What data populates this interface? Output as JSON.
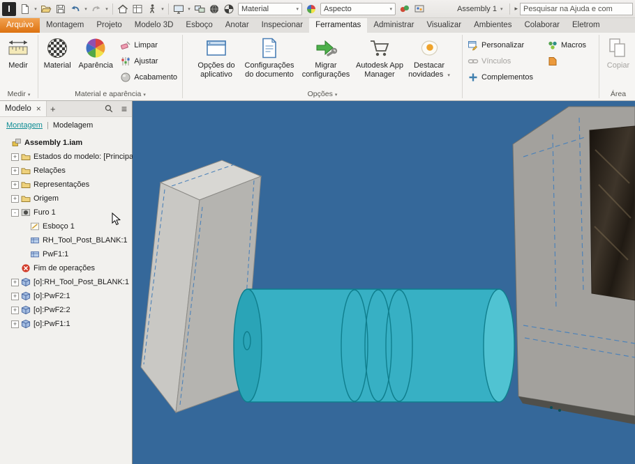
{
  "titlebar": {
    "app_initial": "I",
    "material_combo": "Material",
    "appearance_combo": "Aspecto",
    "document_name": "Assembly 1",
    "search_text": "Pesquisar na Ajuda e com"
  },
  "ribbon": {
    "tabs": [
      {
        "label": "Arquivo",
        "state": "file"
      },
      {
        "label": "Montagem"
      },
      {
        "label": "Projeto"
      },
      {
        "label": "Modelo 3D"
      },
      {
        "label": "Esboço"
      },
      {
        "label": "Anotar"
      },
      {
        "label": "Inspecionar"
      },
      {
        "label": "Ferramentas",
        "state": "active"
      },
      {
        "label": "Administrar"
      },
      {
        "label": "Visualizar"
      },
      {
        "label": "Ambientes"
      },
      {
        "label": "Colaborar"
      },
      {
        "label": "Eletrom"
      }
    ],
    "groups": {
      "medir": {
        "button": "Medir",
        "footer": "Medir"
      },
      "material": {
        "material": "Material",
        "aparencia": "Aparência",
        "limpar": "Limpar",
        "ajustar": "Ajustar",
        "acabamento": "Acabamento",
        "footer": "Material e aparência"
      },
      "opcoes": {
        "app_options": "Opções do aplicativo",
        "doc_settings": "Configurações do documento",
        "migrate": "Migrar configurações",
        "app_manager": "Autodesk App Manager",
        "highlight": "Destacar novidades",
        "footer": "Opções"
      },
      "addins": {
        "personalizar": "Personalizar",
        "vinculos": "Vínculos",
        "complementos": "Complementos",
        "macros": "Macros"
      },
      "clipboard": {
        "copiar": "Copiar",
        "footer": "Área"
      }
    }
  },
  "browser": {
    "tab_label": "Modelo",
    "mode_primary": "Montagem",
    "mode_secondary": "Modelagem",
    "tree": [
      {
        "label": "Assembly 1.iam",
        "level": 0,
        "icon": "assembly",
        "bold": true
      },
      {
        "label": "Estados do modelo: [Principal]",
        "level": 1,
        "icon": "folder",
        "exp": "+"
      },
      {
        "label": "Relações",
        "level": 1,
        "icon": "folder",
        "exp": "+"
      },
      {
        "label": "Representações",
        "level": 1,
        "icon": "folder",
        "exp": "+"
      },
      {
        "label": "Origem",
        "level": 1,
        "icon": "folder",
        "exp": "+"
      },
      {
        "label": "Furo 1",
        "level": 1,
        "icon": "hole",
        "exp": "-"
      },
      {
        "label": "Esboço 1",
        "level": 2,
        "icon": "sketch"
      },
      {
        "label": "RH_Tool_Post_BLANK:1",
        "level": 2,
        "icon": "subpart"
      },
      {
        "label": "PwF1:1",
        "level": 2,
        "icon": "subpart"
      },
      {
        "label": "Fim de operações",
        "level": 1,
        "icon": "eop"
      },
      {
        "label": "[o]:RH_Tool_Post_BLANK:1",
        "level": 1,
        "icon": "component",
        "exp": "+"
      },
      {
        "label": "[o]:PwF2:1",
        "level": 1,
        "icon": "component",
        "exp": "+"
      },
      {
        "label": "[o]:PwF2:2",
        "level": 1,
        "icon": "component",
        "exp": "+"
      },
      {
        "label": "[o]:PwF1:1",
        "level": 1,
        "icon": "component",
        "exp": "+"
      }
    ]
  },
  "viewport": {
    "background_color": "#35689a",
    "cylinder_color": "#38b4c6",
    "box_color": "#c9c8c4",
    "block_color": "#a3a19d"
  }
}
